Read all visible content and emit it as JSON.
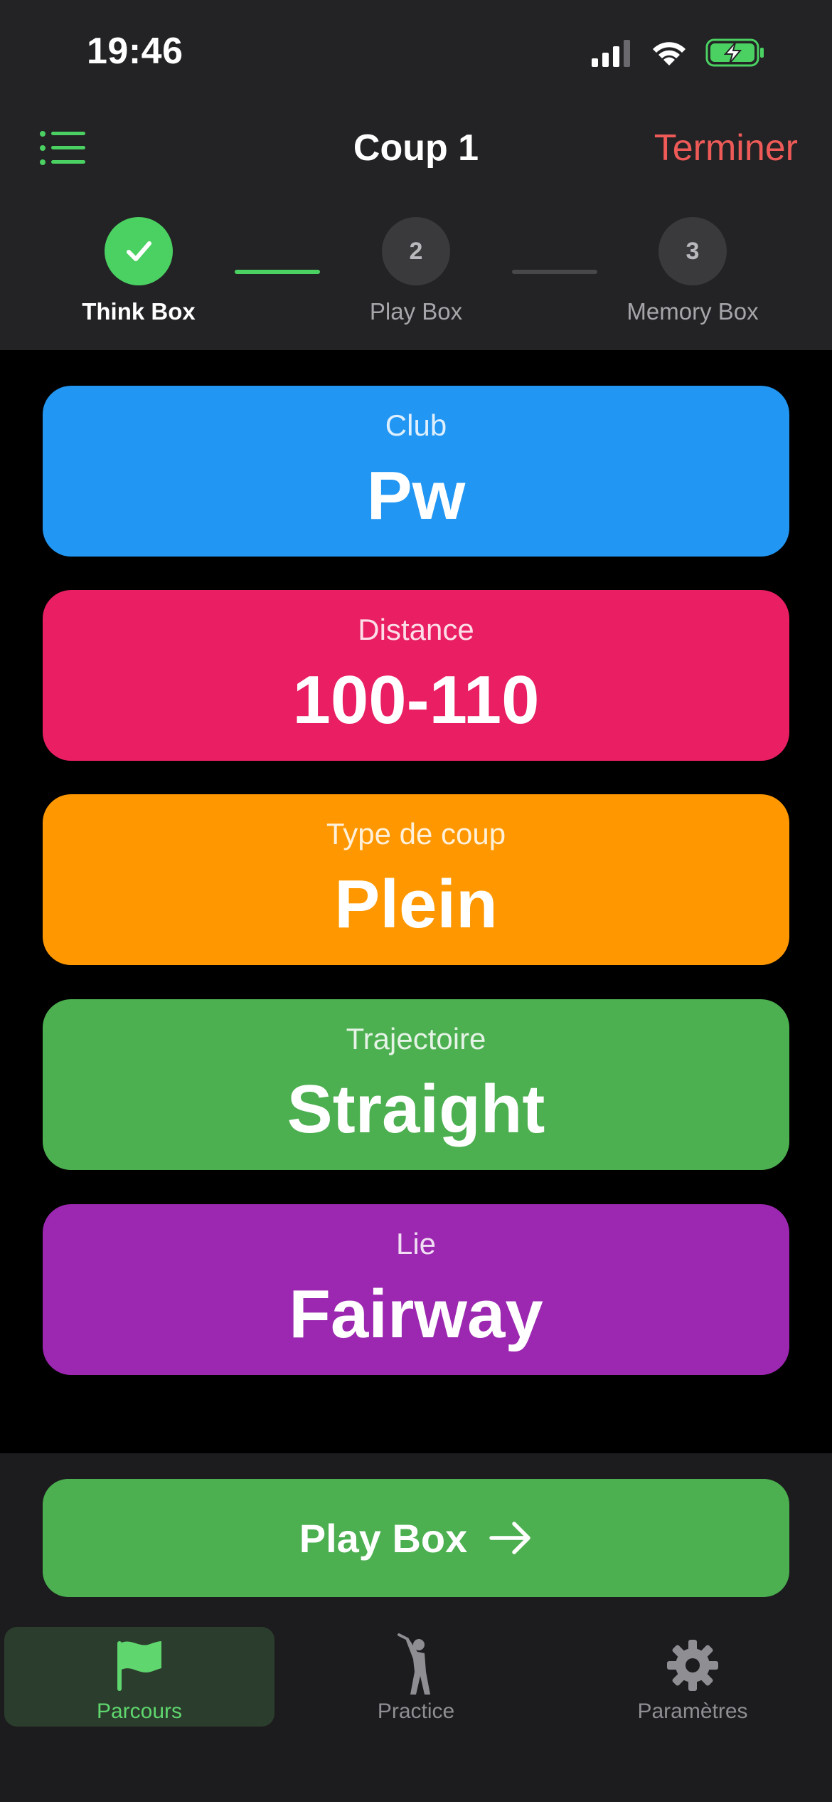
{
  "status_bar": {
    "time": "19:46"
  },
  "nav": {
    "title": "Coup 1",
    "action": "Terminer"
  },
  "stepper": {
    "steps": [
      {
        "number": "",
        "label": "Think Box",
        "state": "done"
      },
      {
        "number": "2",
        "label": "Play Box",
        "state": "pending"
      },
      {
        "number": "3",
        "label": "Memory Box",
        "state": "pending"
      }
    ]
  },
  "cards": [
    {
      "label": "Club",
      "value": "Pw",
      "color": "#2196F3"
    },
    {
      "label": "Distance",
      "value": "100-110",
      "color": "#E91E63"
    },
    {
      "label": "Type de coup",
      "value": "Plein",
      "color": "#FF9800"
    },
    {
      "label": "Trajectoire",
      "value": "Straight",
      "color": "#4CAF50"
    },
    {
      "label": "Lie",
      "value": "Fairway",
      "color": "#9C27B0"
    }
  ],
  "primary_button": {
    "label": "Play Box",
    "icon": "arrow-right-icon"
  },
  "tabbar": {
    "tabs": [
      {
        "label": "Parcours",
        "icon": "flag-icon",
        "active": true
      },
      {
        "label": "Practice",
        "icon": "golfer-icon",
        "active": false
      },
      {
        "label": "Paramètres",
        "icon": "gear-icon",
        "active": false
      }
    ]
  },
  "colors": {
    "accent_green": "#4BD062",
    "destructive": "#EE5A57",
    "header_bg": "#232325"
  }
}
